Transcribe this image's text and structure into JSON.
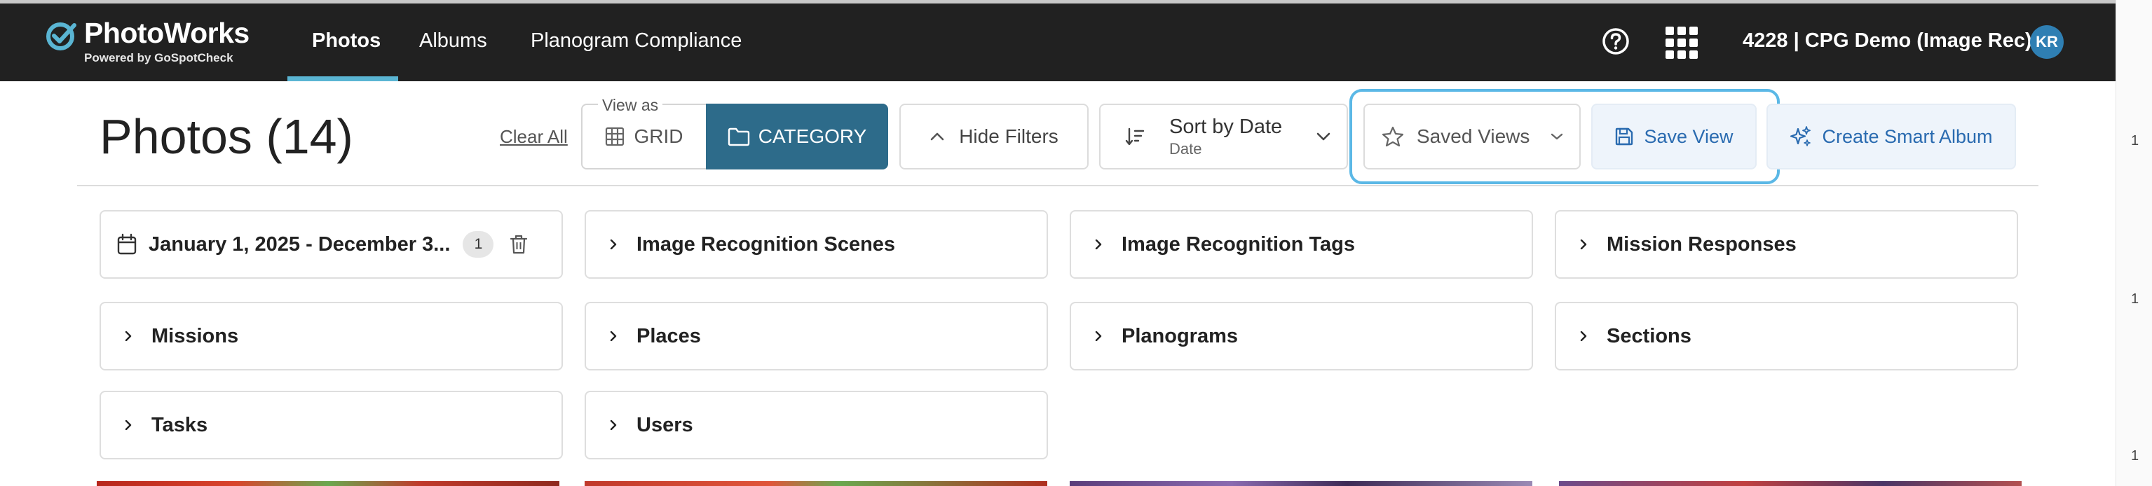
{
  "nav": {
    "brand": "PhotoWorks",
    "brand_sub": "Powered by GoSpotCheck",
    "tabs": [
      {
        "label": "Photos",
        "active": true
      },
      {
        "label": "Albums",
        "active": false
      },
      {
        "label": "Planogram Compliance",
        "active": false
      }
    ],
    "account": "4228 | CPG Demo (Image Rec)",
    "avatar_initials": "KR",
    "icons": [
      "help-circle-icon",
      "apps-grid-icon"
    ]
  },
  "toolbar": {
    "title": "Photos (14)",
    "clear_all": "Clear All",
    "view_as_label": "View as",
    "view_options": [
      {
        "label": "GRID",
        "icon": "grid-icon",
        "selected": false
      },
      {
        "label": "CATEGORY",
        "icon": "folder-icon",
        "selected": true
      }
    ],
    "hide_filters": "Hide Filters",
    "sort_label": "Sort by Date",
    "sort_sub": "Date",
    "saved_views": "Saved Views",
    "save_view": "Save View",
    "create_smart_album": "Create Smart Album"
  },
  "filters": {
    "date_range": {
      "label": "January 1, 2025 - December 3...",
      "count": "1"
    },
    "items": [
      "Image Recognition Scenes",
      "Image Recognition Tags",
      "Mission Responses",
      "Missions",
      "Places",
      "Planograms",
      "Sections",
      "Tasks",
      "Users"
    ]
  },
  "edge_marks": [
    "1",
    "1",
    "1"
  ],
  "colors": {
    "nav_bg": "#212121",
    "active_tab_underline": "#5ab5d3",
    "category_selected": "#2d6b8a",
    "accent_blue": "#2a6bb0",
    "highlight_outline": "#5bb8e6",
    "avatar_bg": "#2f7fb3"
  }
}
